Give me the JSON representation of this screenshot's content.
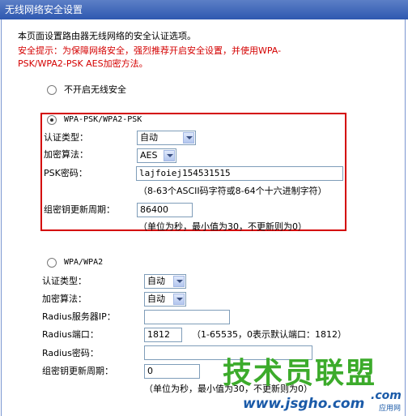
{
  "header": {
    "title": "无线网络安全设置"
  },
  "intro": {
    "line1": "本页面设置路由器无线网络的安全认证选项。",
    "tip_line1": "安全提示：为保障网络安全，强烈推荐开启安全设置，并使用WPA-",
    "tip_line2": "PSK/WPA2-PSK AES加密方法。"
  },
  "option_disable": {
    "label": "不开启无线安全",
    "selected": false
  },
  "wpa_psk": {
    "label": "WPA-PSK/WPA2-PSK",
    "selected": true,
    "auth_type_label": "认证类型：",
    "auth_type_value": "自动",
    "encryption_label": "加密算法：",
    "encryption_value": "AES",
    "psk_label": "PSK密码：",
    "psk_value": "lajfoiej154531515",
    "psk_hint": "（8-63个ASCII码字符或8-64个十六进制字符）",
    "group_key_label": "组密钥更新周期：",
    "group_key_value": "86400",
    "group_key_hint": "（单位为秒，最小值为30，不更新则为0）"
  },
  "wpa": {
    "label": "WPA/WPA2",
    "selected": false,
    "auth_type_label": "认证类型：",
    "auth_type_value": "自动",
    "encryption_label": "加密算法：",
    "encryption_value": "自动",
    "radius_ip_label": "Radius服务器IP：",
    "radius_ip_value": "",
    "radius_port_label": "Radius端口：",
    "radius_port_value": "1812",
    "radius_port_hint": "（1-65535，0表示默认端口：1812）",
    "radius_pwd_label": "Radius密码：",
    "radius_pwd_value": "",
    "group_key_label": "组密钥更新周期：",
    "group_key_value": "0",
    "group_key_hint": "（单位为秒，最小值为30，不更新则为0）"
  },
  "watermark": {
    "brand": "技术员联盟",
    "url": "www.jsgho.com",
    "com": ".com",
    "sub": "应用网"
  },
  "colors": {
    "accent_red": "#d40000",
    "header_blue": "#2e58b0",
    "watermark_green": "#3cab2b"
  }
}
